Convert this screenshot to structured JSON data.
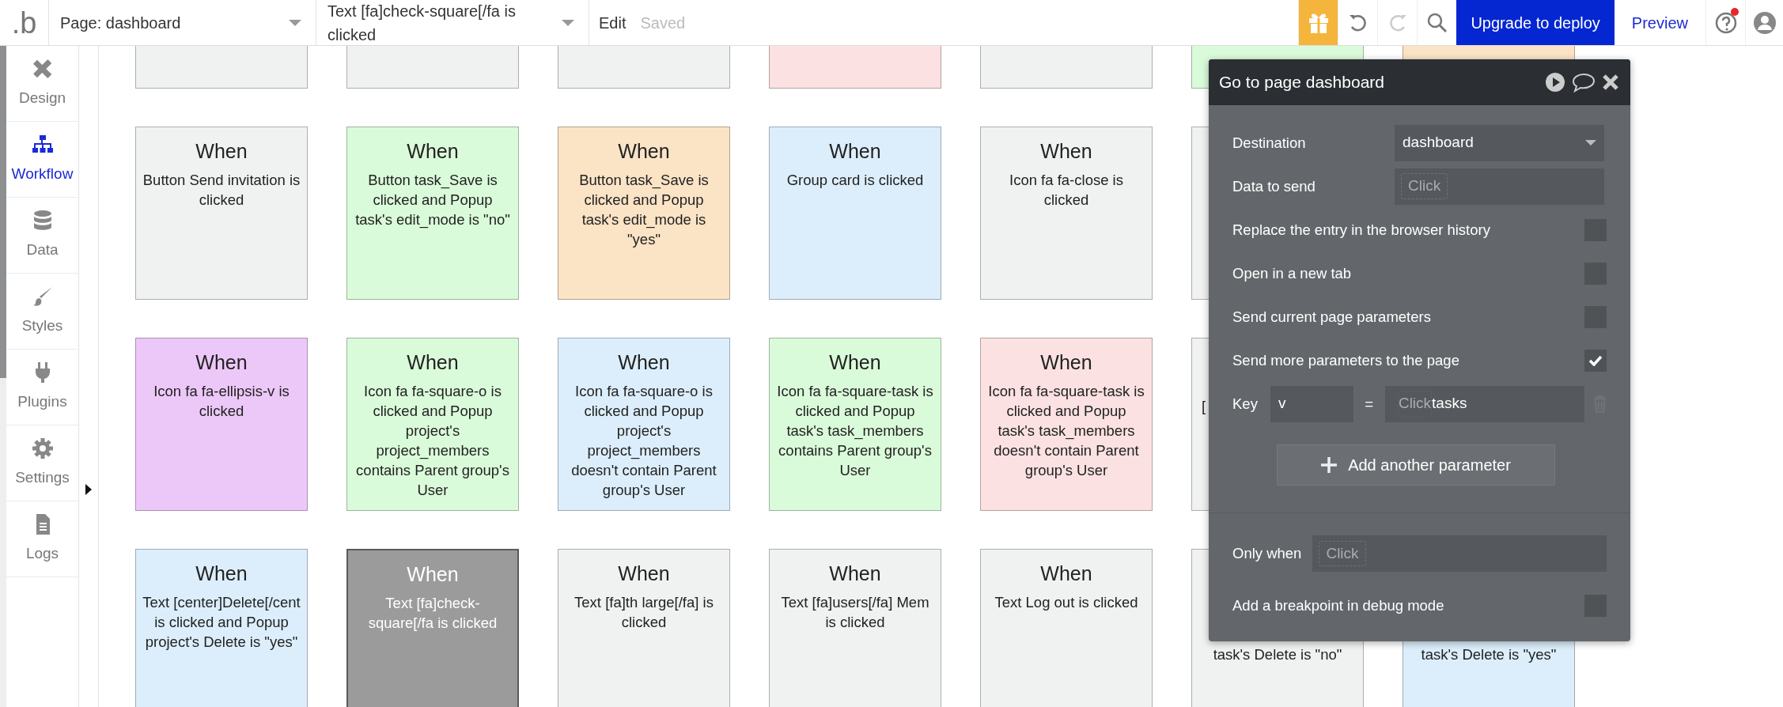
{
  "toolbar": {
    "logo": ".b",
    "page_select": {
      "value": "Page: dashboard"
    },
    "workflow_select": {
      "value": "Text [fa]check-square[/fa is clicked"
    },
    "edit_label": "Edit",
    "save_status": "Saved",
    "redo": {
      "disabled": true
    },
    "upgrade_button": "Upgrade to deploy",
    "preview_link": "Preview",
    "help": {
      "notification": true
    }
  },
  "sidebar": {
    "items": [
      {
        "label": "Design",
        "selected": false
      },
      {
        "label": "Workflow",
        "selected": true
      },
      {
        "label": "Data",
        "selected": false
      },
      {
        "label": "Styles",
        "selected": false
      },
      {
        "label": "Plugins",
        "selected": false
      },
      {
        "label": "Settings",
        "selected": false
      },
      {
        "label": "Logs",
        "selected": false
      }
    ]
  },
  "canvas": {
    "rows": [
      [
        {
          "kind": "stub",
          "color": "#f0f1f1",
          "selected": false
        },
        {
          "kind": "stub",
          "color": "#f0f1f1",
          "selected": false
        },
        {
          "kind": "stub",
          "color": "#f0f1f1",
          "selected": false
        },
        {
          "kind": "stub",
          "color": "#fbe1e1",
          "selected": false
        },
        {
          "kind": "stub",
          "color": "#f0f1f1",
          "selected": false
        },
        {
          "kind": "stub",
          "color": "#dafbd9",
          "selected": false
        },
        {
          "kind": "stub",
          "color": "#fbe3c5",
          "selected": false
        }
      ],
      [
        {
          "kind": "full",
          "heading": "When",
          "text": "Button Send invitation is clicked",
          "color": "#f0f1f1",
          "selected": false
        },
        {
          "kind": "full",
          "heading": "When",
          "text": "Button task_Save is clicked and Popup task's edit_mode is \"no\"",
          "color": "#dafbd9",
          "selected": false
        },
        {
          "kind": "full",
          "heading": "When",
          "text": "Button task_Save is clicked and Popup task's edit_mode is \"yes\"",
          "color": "#fbe3c5",
          "selected": false
        },
        {
          "kind": "full",
          "heading": "When",
          "text": "Group card is clicked",
          "color": "#dceefb",
          "selected": false
        },
        {
          "kind": "full",
          "heading": "When",
          "text": "Icon fa fa-close is clicked",
          "color": "#f0f1f1",
          "selected": false
        },
        {
          "kind": "covered",
          "color": "#f0f1f1",
          "selected": false
        }
      ],
      [
        {
          "kind": "full",
          "heading": "When",
          "text": "Icon fa fa-ellipsis-v is clicked",
          "color": "#ecc8f8",
          "selected": false
        },
        {
          "kind": "full",
          "heading": "When",
          "text": "Icon fa fa-square-o is clicked and Popup project's project_members contains Parent group's User",
          "color": "#dafbd9",
          "selected": false
        },
        {
          "kind": "full",
          "heading": "When",
          "text": "Icon fa fa-square-o is clicked and Popup project's project_members doesn't contain Parent group's User",
          "color": "#dceefb",
          "selected": false
        },
        {
          "kind": "full",
          "heading": "When",
          "text": "Icon fa fa-square-task is clicked and Popup task's task_members contains Parent group's User",
          "color": "#dafbd9",
          "selected": false
        },
        {
          "kind": "full",
          "heading": "When",
          "text": "Icon fa fa-square-task is clicked and Popup task's task_members doesn't contain Parent group's User",
          "color": "#fbe1e1",
          "selected": false
        },
        {
          "kind": "covered-mid",
          "text": "[",
          "color": "#f0f1f1",
          "selected": false
        }
      ],
      [
        {
          "kind": "full",
          "heading": "When",
          "text": "Text [center]Delete[/cent is clicked and Popup project's Delete is \"yes\"",
          "color": "#dceefb",
          "selected": false
        },
        {
          "kind": "full",
          "heading": "When",
          "text": "Text [fa]check-square[/fa is clicked",
          "color": "#9b9b9b",
          "selected": true
        },
        {
          "kind": "full",
          "heading": "When",
          "text": "Text [fa]th large[/fa] is clicked",
          "color": "#f0f1f1",
          "selected": false
        },
        {
          "kind": "full",
          "heading": "When",
          "text": "Text [fa]users[/fa] Mem is clicked",
          "color": "#f0f1f1",
          "selected": false
        },
        {
          "kind": "full",
          "heading": "When",
          "text": "Text Log out is clicked",
          "color": "#f0f1f1",
          "selected": false
        },
        {
          "kind": "covered-low",
          "text": "task's Delete is \"no\"",
          "color": "#f0f1f1",
          "selected": false
        },
        {
          "kind": "covered-low",
          "text": "task's Delete is \"yes\"",
          "color": "#dceefb",
          "selected": false
        }
      ]
    ]
  },
  "panel": {
    "title": "Go to page dashboard",
    "fields": [
      {
        "kind": "select",
        "label": "Destination",
        "value": "dashboard"
      },
      {
        "kind": "expression",
        "label": "Data to send",
        "token": "Click"
      },
      {
        "kind": "checkbox",
        "label": "Replace the entry in the browser history",
        "checked": false
      },
      {
        "kind": "checkbox",
        "label": "Open in a new tab",
        "checked": false
      },
      {
        "kind": "checkbox",
        "label": "Send current page parameters",
        "checked": false
      },
      {
        "kind": "checkbox",
        "label": "Send more parameters to the page",
        "checked": true
      },
      {
        "kind": "param",
        "label": "Key",
        "key": "v",
        "equals": "=",
        "token": "Click",
        "value": "tasks"
      },
      {
        "kind": "button",
        "label": "Add another parameter"
      }
    ],
    "footer": [
      {
        "kind": "condition",
        "label": "Only when",
        "token": "Click"
      },
      {
        "kind": "checkbox",
        "label": "Add a breakpoint in debug mode",
        "checked": false
      }
    ]
  }
}
